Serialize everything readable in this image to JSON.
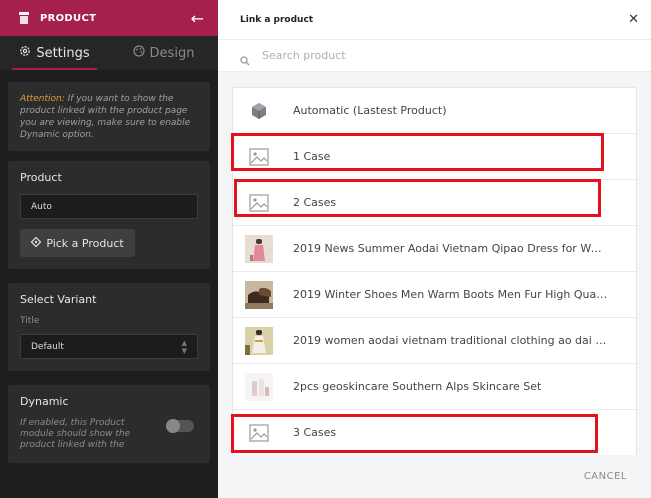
{
  "left_panel": {
    "header_title": "PRODUCT",
    "back_icon": "arrow-left-icon",
    "tabs": [
      {
        "label": "Settings",
        "icon": "gear-icon",
        "active": true
      },
      {
        "label": "Design",
        "icon": "palette-icon",
        "active": false
      }
    ],
    "note": {
      "attention": "Attention:",
      "text": " If you want to show the product linked with the product page you are viewing, make sure to enable Dynamic option."
    },
    "product_section": {
      "title": "Product",
      "field_value": "Auto",
      "pick_button": "Pick a Product",
      "pick_icon": "diamond-move-icon"
    },
    "variant_section": {
      "title": "Select Variant",
      "sub_label": "Title",
      "select_value": "Default"
    },
    "dynamic_section": {
      "title": "Dynamic",
      "description": "If enabled, this Product module should show the product linked with the",
      "toggle_on": false
    }
  },
  "modal": {
    "title": "Link a product",
    "close_icon": "close-icon",
    "search_placeholder": "Search product",
    "items": [
      {
        "name": "Automatic (Lastest Product)",
        "thumb": "box-icon"
      },
      {
        "name": "1 Case",
        "thumb": "image-placeholder-icon"
      },
      {
        "name": "2 Cases",
        "thumb": "image-placeholder-icon"
      },
      {
        "name": "2019 News Summer Aodai Vietnam Qipao Dress for Wom...",
        "thumb": "photo"
      },
      {
        "name": "2019 Winter Shoes Men Warm Boots Men Fur High Quality ...",
        "thumb": "photo"
      },
      {
        "name": "2019 women aodai vietnam traditional clothing ao dai vie...",
        "thumb": "photo"
      },
      {
        "name": "2pcs geoskincare Southern Alps Skincare Set",
        "thumb": "photo"
      },
      {
        "name": "3 Cases",
        "thumb": "image-placeholder-icon"
      }
    ],
    "cancel_label": "CANCEL"
  },
  "colors": {
    "accent": "#a6204e",
    "highlight": "#e3121b",
    "attention": "#d9a13b"
  }
}
